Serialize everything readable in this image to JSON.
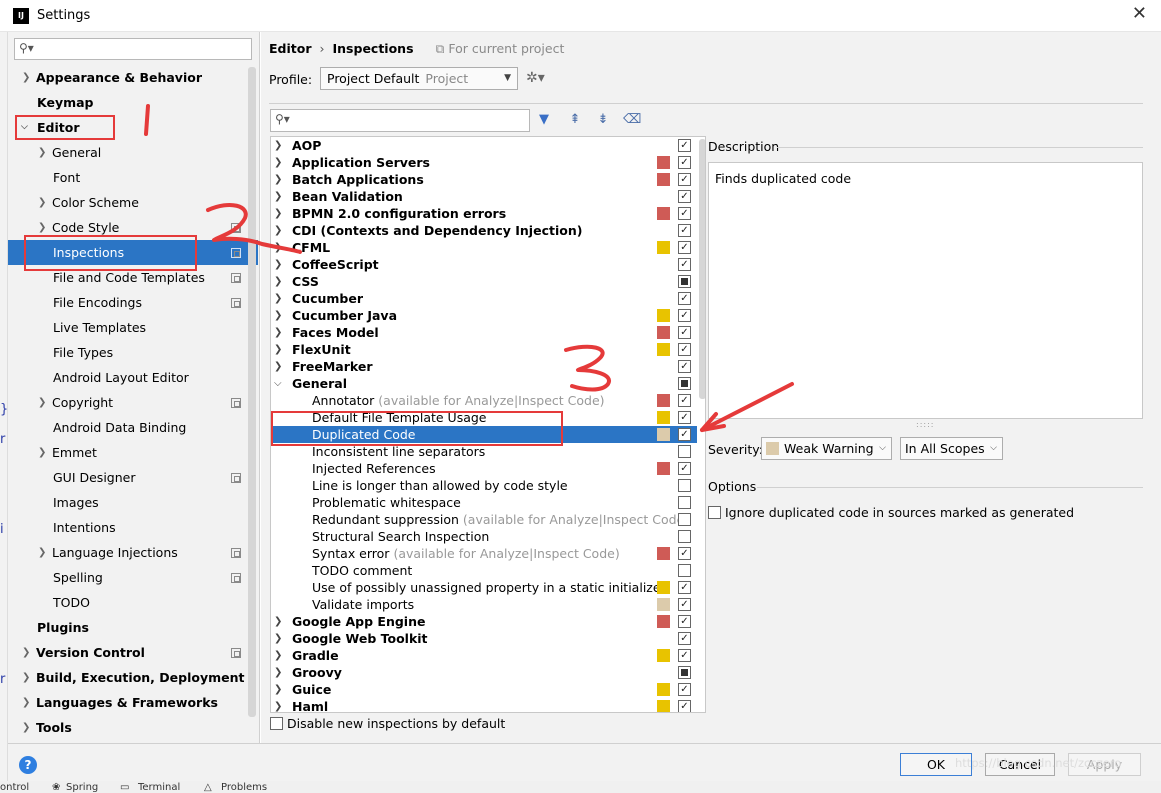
{
  "window": {
    "title": "Settings",
    "close_glyph": "✕"
  },
  "sidebar": {
    "search_placeholder": "",
    "items": [
      {
        "label": "Appearance & Behavior"
      },
      {
        "label": "Keymap"
      },
      {
        "label": "Editor"
      },
      {
        "label": "General"
      },
      {
        "label": "Font"
      },
      {
        "label": "Color Scheme"
      },
      {
        "label": "Code Style"
      },
      {
        "label": "Inspections"
      },
      {
        "label": "File and Code Templates"
      },
      {
        "label": "File Encodings"
      },
      {
        "label": "Live Templates"
      },
      {
        "label": "File Types"
      },
      {
        "label": "Android Layout Editor"
      },
      {
        "label": "Copyright"
      },
      {
        "label": "Android Data Binding"
      },
      {
        "label": "Emmet"
      },
      {
        "label": "GUI Designer"
      },
      {
        "label": "Images"
      },
      {
        "label": "Intentions"
      },
      {
        "label": "Language Injections"
      },
      {
        "label": "Spelling"
      },
      {
        "label": "TODO"
      },
      {
        "label": "Plugins"
      },
      {
        "label": "Version Control"
      },
      {
        "label": "Build, Execution, Deployment"
      },
      {
        "label": "Languages & Frameworks"
      },
      {
        "label": "Tools"
      }
    ]
  },
  "breadcrumb": {
    "editor": "Editor",
    "sep": "›",
    "inspections": "Inspections",
    "scope": "For current project"
  },
  "profile": {
    "label": "Profile:",
    "value": "Project Default",
    "scope": "Project"
  },
  "inspection_list": [
    {
      "label": "AOP",
      "extra": ""
    },
    {
      "label": "Application Servers",
      "extra": ""
    },
    {
      "label": "Batch Applications",
      "extra": ""
    },
    {
      "label": "Bean Validation",
      "extra": ""
    },
    {
      "label": "BPMN 2.0 configuration errors",
      "extra": ""
    },
    {
      "label": "CDI (Contexts and Dependency Injection)",
      "extra": ""
    },
    {
      "label": "CFML",
      "extra": ""
    },
    {
      "label": "CoffeeScript",
      "extra": ""
    },
    {
      "label": "CSS",
      "extra": ""
    },
    {
      "label": "Cucumber",
      "extra": ""
    },
    {
      "label": "Cucumber Java",
      "extra": ""
    },
    {
      "label": "Faces Model",
      "extra": ""
    },
    {
      "label": "FlexUnit",
      "extra": ""
    },
    {
      "label": "FreeMarker",
      "extra": ""
    },
    {
      "label": "General",
      "extra": ""
    },
    {
      "label": "Annotator",
      "extra": "(available for Analyze|Inspect Code)"
    },
    {
      "label": "Default File Template Usage",
      "extra": ""
    },
    {
      "label": "Duplicated Code",
      "extra": ""
    },
    {
      "label": "Inconsistent line separators",
      "extra": ""
    },
    {
      "label": "Injected References",
      "extra": ""
    },
    {
      "label": "Line is longer than allowed by code style",
      "extra": ""
    },
    {
      "label": "Problematic whitespace",
      "extra": ""
    },
    {
      "label": "Redundant suppression",
      "extra": "(available for Analyze|Inspect Code"
    },
    {
      "label": "Structural Search Inspection",
      "extra": ""
    },
    {
      "label": "Syntax error",
      "extra": "(available for Analyze|Inspect Code)"
    },
    {
      "label": "TODO comment",
      "extra": ""
    },
    {
      "label": "Use of possibly unassigned property in a static initializer",
      "extra": ""
    },
    {
      "label": "Validate imports",
      "extra": ""
    },
    {
      "label": "Google App Engine",
      "extra": ""
    },
    {
      "label": "Google Web Toolkit",
      "extra": ""
    },
    {
      "label": "Gradle",
      "extra": ""
    },
    {
      "label": "Groovy",
      "extra": ""
    },
    {
      "label": "Guice",
      "extra": ""
    },
    {
      "label": "Haml",
      "extra": ""
    }
  ],
  "severity_colors": {
    "error": "#cf5b56",
    "warning": "#e8c300",
    "weak": "#dccbab",
    "selection": "#2b75c5"
  },
  "bottom_checkbox": "Disable new inspections by default",
  "description": {
    "label": "Description",
    "text": "Finds duplicated code"
  },
  "severity": {
    "label": "Severity:",
    "value": "Weak Warning",
    "scope": "In All Scopes"
  },
  "options": {
    "label": "Options",
    "checkbox": "Ignore duplicated code in sources marked as generated"
  },
  "footer": {
    "help": "?",
    "ok": "OK",
    "cancel": "Cancel",
    "apply": "Apply"
  },
  "watermark": "https://blog.csdn.net/zcczero",
  "taskbar": {
    "a": "ontrol",
    "b": "Spring",
    "c": "Terminal",
    "d": "Problems"
  }
}
